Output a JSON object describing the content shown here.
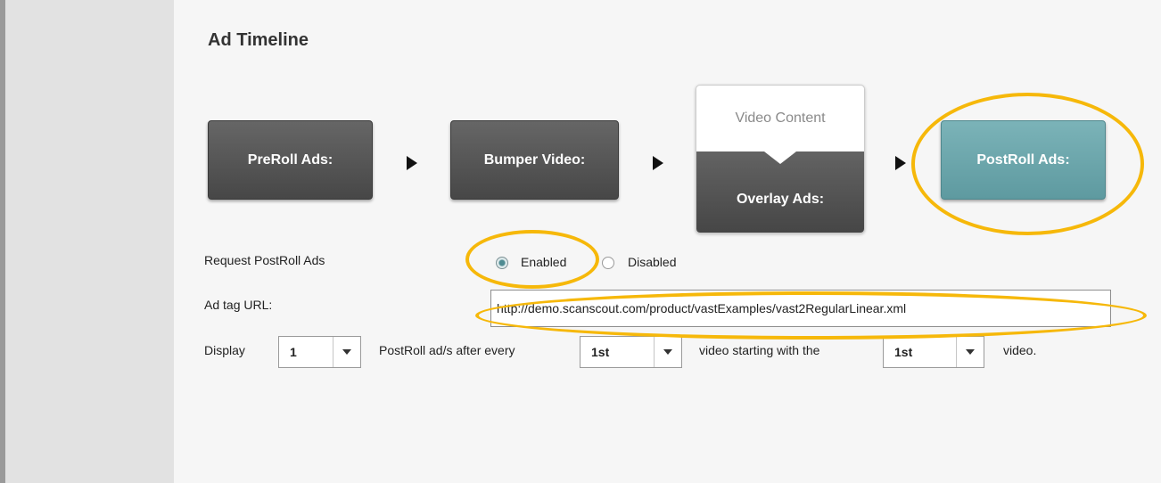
{
  "section": {
    "title": "Ad Timeline"
  },
  "timeline": {
    "preroll_label": "PreRoll Ads:",
    "bumper_label": "Bumper Video:",
    "video_content_label": "Video Content",
    "overlay_label": "Overlay Ads:",
    "postroll_label": "PostRoll Ads:"
  },
  "request": {
    "label": "Request PostRoll Ads",
    "enabled_label": "Enabled",
    "disabled_label": "Disabled",
    "selected": "Enabled"
  },
  "ad_tag": {
    "label": "Ad tag URL:",
    "value": "http://demo.scanscout.com/product/vastExamples/vast2RegularLinear.xml"
  },
  "display_row": {
    "display_label": "Display",
    "count_value": "1",
    "after_every_label": "PostRoll ad/s after every",
    "every_value": "1st",
    "starting_label": "video starting with the",
    "start_value": "1st",
    "video_label": "video."
  },
  "colors": {
    "highlight": "#f6b80a",
    "postroll_tile": "#6fa8ae",
    "dark_tile": "#555555"
  }
}
